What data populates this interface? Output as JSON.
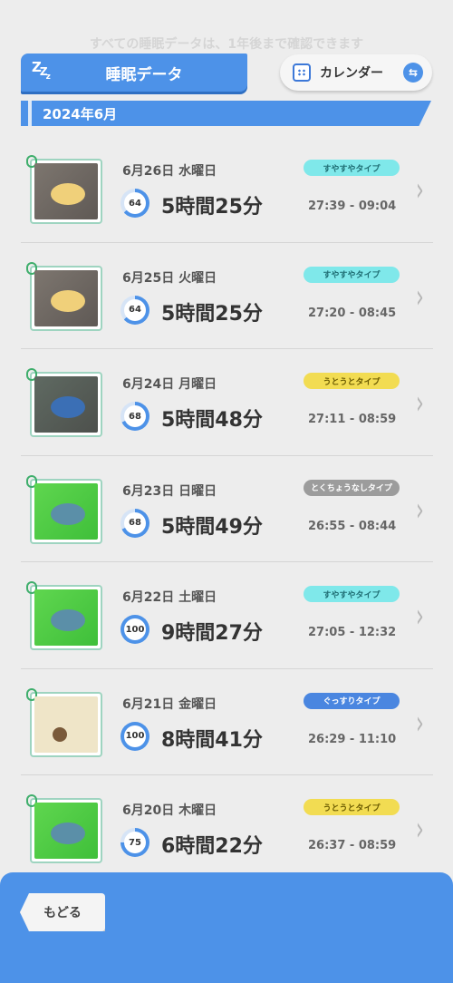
{
  "header": {
    "title": "睡眠データ",
    "calendar_label": "カレンダー",
    "month": "2024年6月",
    "faded_text": "すべての睡眠データは、1年後まで確認できます"
  },
  "entries": [
    {
      "date": "6月26日 水曜日",
      "score": "64",
      "score_pct": 64,
      "duration": "5時間25分",
      "type": "すやすやタイプ",
      "type_color": "#7fe8ea",
      "type_text_color": "#1f6d73",
      "time": "27:39 - 09:04",
      "scene": "rock"
    },
    {
      "date": "6月25日 火曜日",
      "score": "64",
      "score_pct": 64,
      "duration": "5時間25分",
      "type": "すやすやタイプ",
      "type_color": "#7fe8ea",
      "type_text_color": "#1f6d73",
      "time": "27:20 - 08:45",
      "scene": "rock"
    },
    {
      "date": "6月24日 月曜日",
      "score": "68",
      "score_pct": 68,
      "duration": "5時間48分",
      "type": "うとうとタイプ",
      "type_color": "#f2dc52",
      "type_text_color": "#6a5a00",
      "time": "27:11 - 08:59",
      "scene": "cave"
    },
    {
      "date": "6月23日 日曜日",
      "score": "68",
      "score_pct": 68,
      "duration": "5時間49分",
      "type": "とくちょうなしタイプ",
      "type_color": "#9c9c9c",
      "type_text_color": "#ffffff",
      "time": "26:55 - 08:44",
      "scene": "grass"
    },
    {
      "date": "6月22日 土曜日",
      "score": "100",
      "score_pct": 100,
      "duration": "9時間27分",
      "type": "すやすやタイプ",
      "type_color": "#7fe8ea",
      "type_text_color": "#1f6d73",
      "time": "27:05 - 12:32",
      "scene": "grass"
    },
    {
      "date": "6月21日 金曜日",
      "score": "100",
      "score_pct": 100,
      "duration": "8時間41分",
      "type": "ぐっすりタイプ",
      "type_color": "#4a86e0",
      "type_text_color": "#ffffff",
      "time": "26:29 - 11:10",
      "scene": "cream"
    },
    {
      "date": "6月20日 木曜日",
      "score": "75",
      "score_pct": 75,
      "duration": "6時間22分",
      "type": "うとうとタイプ",
      "type_color": "#f2dc52",
      "type_text_color": "#6a5a00",
      "time": "26:37 - 08:59",
      "scene": "grass"
    }
  ],
  "footer": {
    "back_label": "もどる"
  },
  "colors": {
    "accent": "#4d92e8",
    "ring_track": "#d6e4f6"
  },
  "icons": {
    "sleep": "zzz-icon",
    "calendar": "calendar-icon",
    "swap": "swap-icon",
    "chevron": "chevron-right-icon"
  }
}
